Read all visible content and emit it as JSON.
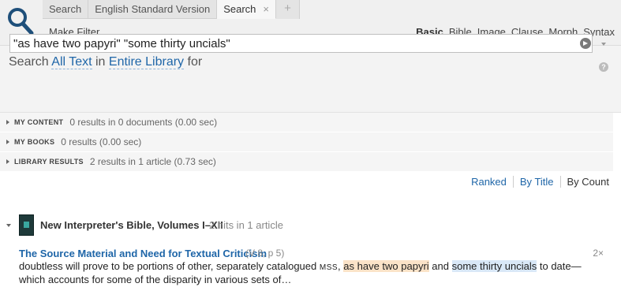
{
  "toolbar": {
    "tabs": [
      {
        "label": "Search",
        "active": false
      },
      {
        "label": "English Standard Version",
        "active": false
      },
      {
        "label": "Search",
        "active": true,
        "close": "×"
      }
    ],
    "add_tab": "+",
    "make_filter": "Make Filter",
    "kinds": [
      "Basic",
      "Bible",
      "Image",
      "Clause",
      "Morph",
      "Syntax"
    ],
    "active_kind": "Basic"
  },
  "search": {
    "prefix": "Search",
    "scope_text": "All Text",
    "in_word": "in",
    "library": "Entire Library",
    "for_word": "for",
    "query": "\"as have two papyri\" \"some thirty uncials\"",
    "help": "?"
  },
  "sections": [
    {
      "title": "MY CONTENT",
      "info": "0 results in 0 documents (0.00 sec)"
    },
    {
      "title": "MY BOOKS",
      "info": "0 results (0.00 sec)"
    },
    {
      "title": "LIBRARY RESULTS",
      "info": "2 results in 1 article (0.73 sec)"
    }
  ],
  "sort": {
    "ranked": "Ranked",
    "by_title": "By Title",
    "by_count": "By Count"
  },
  "result": {
    "book_title": "New Interpreter's Bible, Volumes I–XII",
    "book_hits": "2 hits in 1 article",
    "article_title": "The Source Material and Need for Textual Criticism",
    "article_ref": "(V 8, p 5)",
    "article_count": "2×",
    "snippet": {
      "part1": "doubtless will prove to be portions of other, separately catalogued ",
      "mss": "MSS",
      "part2": ", ",
      "hit1": "as have two papyri",
      "part3": " and ",
      "hit2": "some thirty uncials",
      "part4": " to date—which accounts for some of the disparity in various sets of…"
    }
  },
  "colors": {
    "link": "#1f66a8",
    "hit1_bg": "#fbe3c8",
    "hit2_bg": "#d9e8f7"
  },
  "icons": {
    "logo": "search-magnifier-icon",
    "go": "arrow-right-icon",
    "help": "help-icon"
  }
}
